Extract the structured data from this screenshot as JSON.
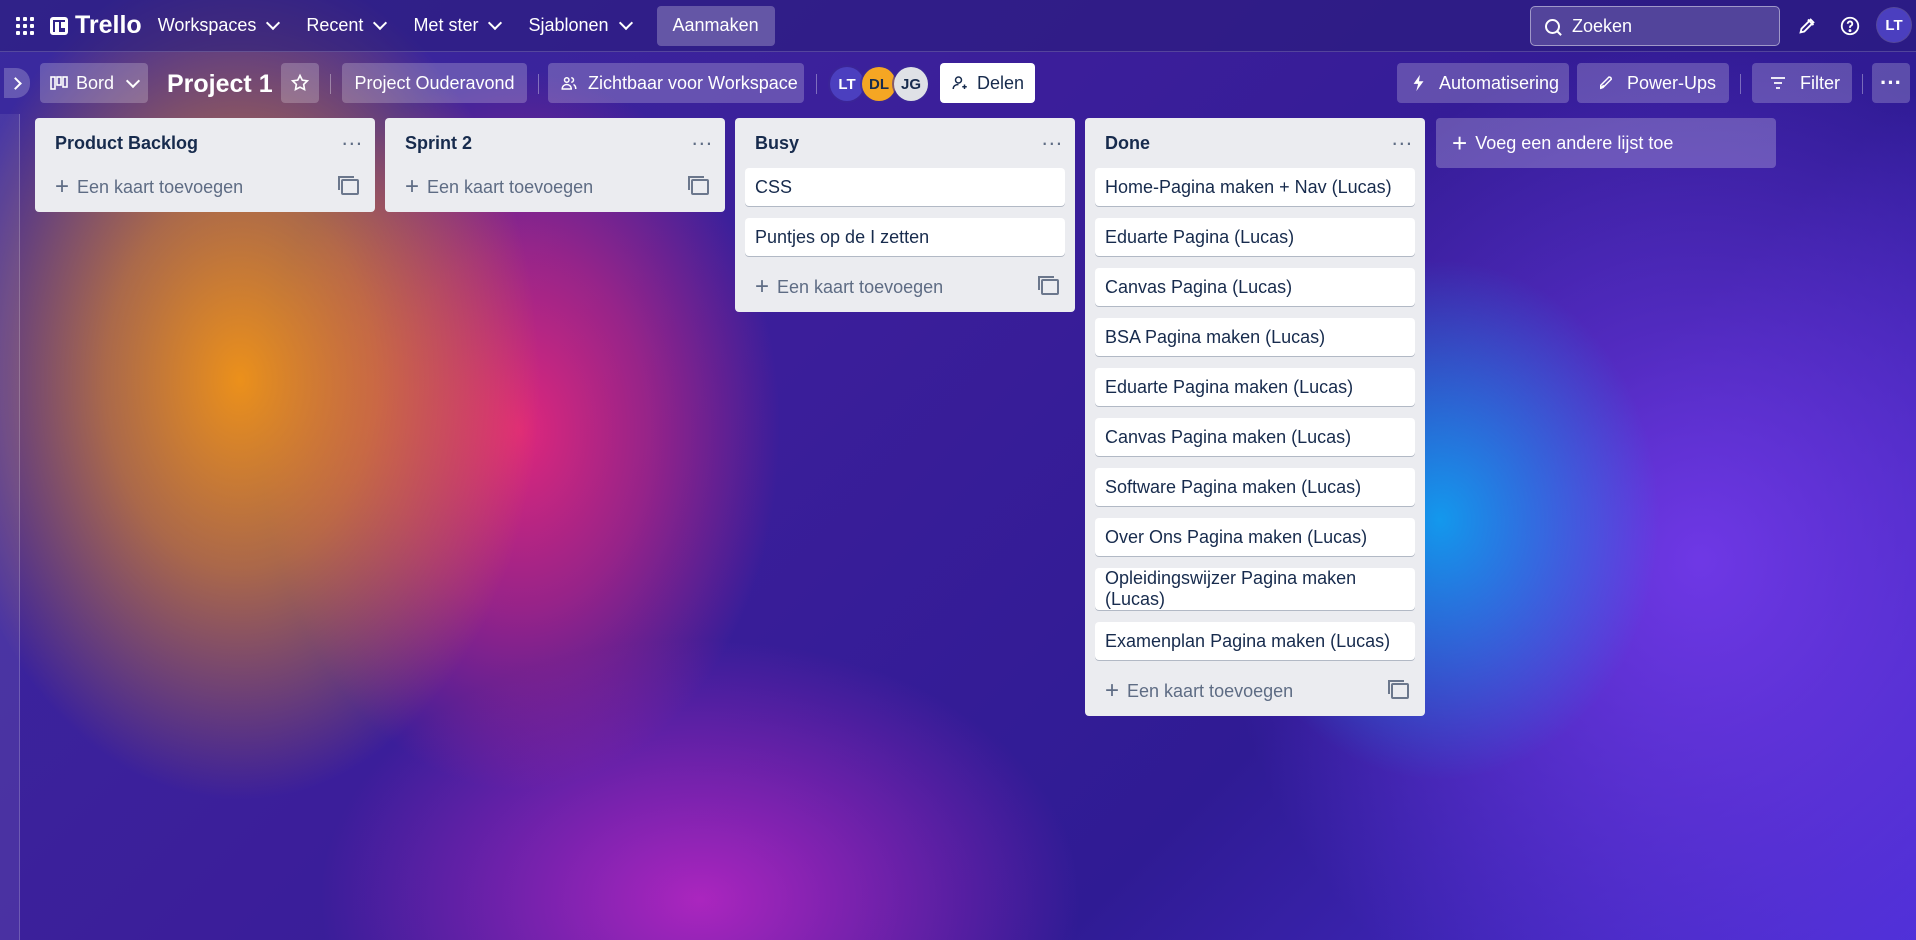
{
  "header": {
    "logo_text": "Trello",
    "nav": [
      {
        "label": "Workspaces"
      },
      {
        "label": "Recent"
      },
      {
        "label": "Met ster"
      },
      {
        "label": "Sjablonen"
      }
    ],
    "create_label": "Aanmaken",
    "search_placeholder": "Zoeken",
    "user_initials": "LT"
  },
  "board": {
    "view_label": "Bord",
    "title": "Project 1",
    "workspace_label": "Project Ouderavond",
    "visibility_label": "Zichtbaar voor Workspace",
    "members": [
      {
        "initials": "LT",
        "bg": "#4b3fbf",
        "fg": "#ffffff"
      },
      {
        "initials": "DL",
        "bg": "#f5a623",
        "fg": "#172b4d"
      },
      {
        "initials": "JG",
        "bg": "#dfe1e6",
        "fg": "#172b4d"
      }
    ],
    "share_label": "Delen",
    "automation_label": "Automatisering",
    "powerups_label": "Power-Ups",
    "filter_label": "Filter"
  },
  "lists": [
    {
      "title": "Product Backlog",
      "cards": [],
      "add_label": "Een kaart toevoegen"
    },
    {
      "title": "Sprint 2",
      "cards": [],
      "add_label": "Een kaart toevoegen"
    },
    {
      "title": "Busy",
      "cards": [
        "CSS",
        "Puntjes op de I zetten"
      ],
      "add_label": "Een kaart toevoegen"
    },
    {
      "title": "Done",
      "cards": [
        "Home-Pagina maken + Nav (Lucas)",
        "Eduarte Pagina (Lucas)",
        "Canvas Pagina (Lucas)",
        "BSA Pagina maken (Lucas)",
        "Eduarte Pagina maken (Lucas)",
        "Canvas Pagina maken (Lucas)",
        "Software Pagina maken (Lucas)",
        "Over Ons Pagina maken (Lucas)",
        "Opleidingswijzer Pagina maken (Lucas)",
        "Examenplan Pagina maken (Lucas)"
      ],
      "add_label": "Een kaart toevoegen"
    }
  ],
  "add_list_label": "Voeg een andere lijst toe"
}
